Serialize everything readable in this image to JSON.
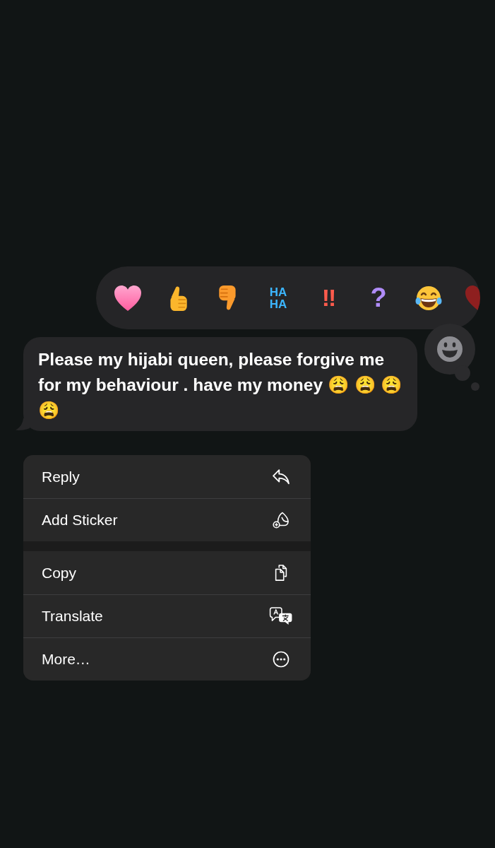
{
  "reactions": [
    {
      "kind": "heart"
    },
    {
      "kind": "thumbs-up"
    },
    {
      "kind": "thumbs-down"
    },
    {
      "kind": "haha",
      "label": "HA HA"
    },
    {
      "kind": "exclamation",
      "label": "!!"
    },
    {
      "kind": "question",
      "label": "?"
    },
    {
      "kind": "laughing"
    },
    {
      "kind": "red-heart"
    }
  ],
  "message": {
    "text": "Please my hijabi queen, please forgive me for my behaviour . have my money 😩 😩 😩 😩"
  },
  "menu": {
    "groups": [
      {
        "items": [
          {
            "kind": "reply",
            "label": "Reply"
          },
          {
            "kind": "sticker",
            "label": "Add Sticker"
          }
        ]
      },
      {
        "items": [
          {
            "kind": "copy",
            "label": "Copy"
          },
          {
            "kind": "translate",
            "label": "Translate"
          },
          {
            "kind": "more",
            "label": "More…"
          }
        ]
      }
    ]
  }
}
